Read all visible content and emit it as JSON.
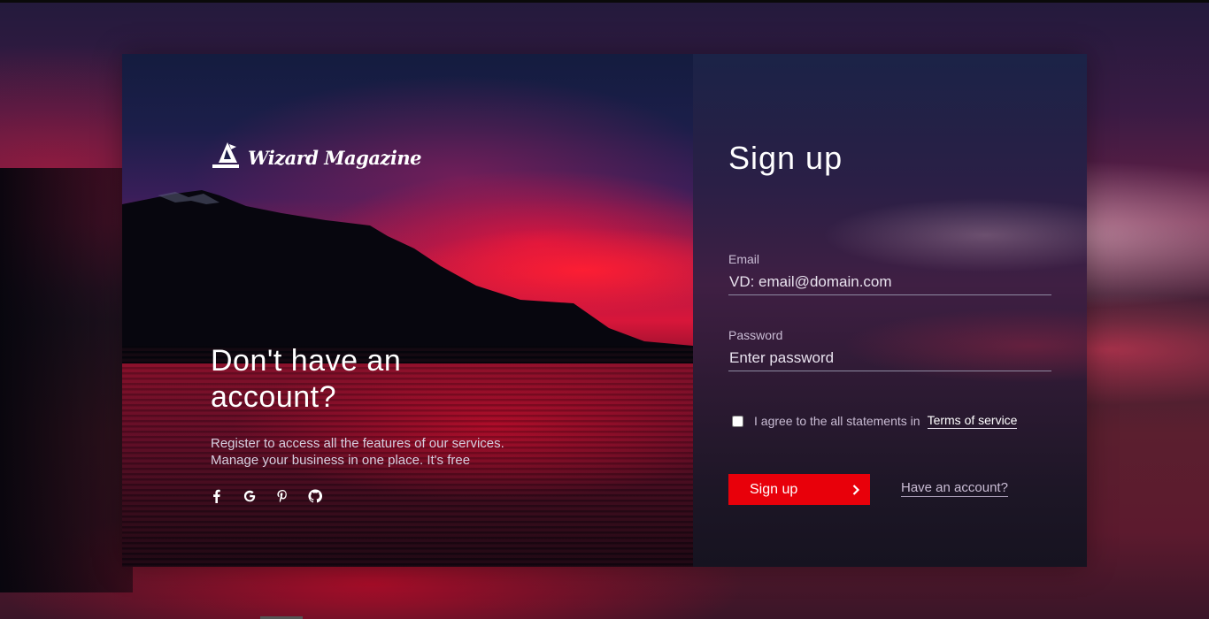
{
  "brand": {
    "name": "Wizard Magazine",
    "logo_icon": "wizard-hat-icon"
  },
  "promo": {
    "headline": "Don't have an account?",
    "subtext_line1": "Register to access all the features of our services.",
    "subtext_line2": "Manage your business in one place. It's free",
    "socials": [
      "facebook-icon",
      "google-icon",
      "pinterest-icon",
      "github-icon"
    ]
  },
  "form": {
    "title": "Sign up",
    "email": {
      "label": "Email",
      "placeholder": "VD: email@domain.com"
    },
    "password": {
      "label": "Password",
      "placeholder": "Enter password"
    },
    "agree_text": "I agree to the all statements in",
    "terms_link": "Terms of service",
    "submit_label": "Sign up",
    "submit_icon": "chevron-right-icon",
    "have_account_link": "Have an account?"
  },
  "colors": {
    "accent": "#e8000a",
    "text_primary": "#ffffff",
    "text_muted": "#c9bcd4"
  }
}
